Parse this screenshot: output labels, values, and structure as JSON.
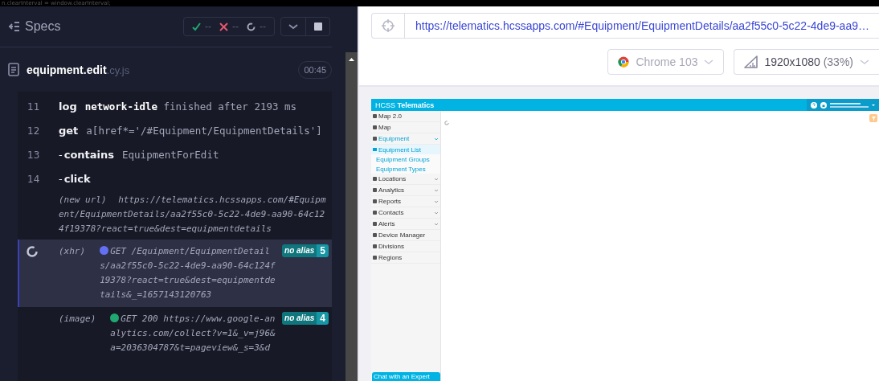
{
  "code_strip": "n.clearInterval = window.clearInterval;",
  "specs": {
    "title": "Specs",
    "passed": "--",
    "failed": "--",
    "pending": "--"
  },
  "spec_file": {
    "name": "equipment.edit",
    "ext": ".cy.js",
    "duration": "00:45"
  },
  "commands": [
    {
      "kind": "command",
      "number": "11",
      "name": "log",
      "message": "**network-idle** finished after 2193 ms"
    },
    {
      "kind": "command",
      "number": "12",
      "name": "get",
      "message": "a[href*='/#Equipment/EquipmentDetails']"
    },
    {
      "kind": "child",
      "number": "13",
      "prefix": "-",
      "name": "contains",
      "message": "EquipmentForEdit"
    },
    {
      "kind": "child",
      "number": "14",
      "prefix": "-",
      "name": "click"
    },
    {
      "kind": "event",
      "label": "(new url)",
      "message": "https://telematics.hcssapps.com/#Equipment/EquipmentDetails/aa2f55c0-5c22-4de9-aa90-64c124f19378?react=true&dest=equipmentdetails"
    },
    {
      "kind": "request",
      "label": "(xhr)",
      "color": "#6470f3",
      "message": "GET /Equipment/EquipmentDetails/aa2f55c0-5c22-4de9-aa90-64c124f19378?react=true&dest=equipmentdetails&_=1657143120763",
      "alias": "no alias",
      "count": "5",
      "pending": true,
      "selected": true
    },
    {
      "kind": "request",
      "label": "(image)",
      "color": "#1fa971",
      "message": "GET 200 https://www.google-analytics.com/collect?v=1&_v=j96&a=2036304787&t=pageview&_s=3&d",
      "alias": "no alias",
      "count": "4",
      "pending": false,
      "selected": false
    }
  ],
  "runner": {
    "url": "https://telematics.hcssapps.com/#Equipment/EquipmentDetails/aa2f55c0-5c22-4de9-aa9…",
    "browser": "Chrome 103",
    "viewport": "1920x1080",
    "scale": "(33%)"
  },
  "preview": {
    "app_title": "HCSS **Telematics**",
    "chat_button": "Chat with an Expert",
    "sidebar": [
      {
        "kind": "link",
        "label": "Map 2.0"
      },
      {
        "kind": "link",
        "label": "Map"
      },
      {
        "kind": "group",
        "label": "Equipment",
        "expanded": true,
        "children": [
          {
            "label": "Equipment List",
            "selected": true
          },
          {
            "label": "Equipment Groups",
            "selected": false
          },
          {
            "label": "Equipment Types",
            "selected": false
          }
        ]
      },
      {
        "kind": "group",
        "label": "Locations",
        "expanded": false
      },
      {
        "kind": "group",
        "label": "Analytics",
        "expanded": false
      },
      {
        "kind": "group",
        "label": "Reports",
        "expanded": false
      },
      {
        "kind": "group",
        "label": "Contacts",
        "expanded": false
      },
      {
        "kind": "group",
        "label": "Alerts",
        "expanded": false
      },
      {
        "kind": "link",
        "label": "Device Manager"
      },
      {
        "kind": "link",
        "label": "Divisions"
      },
      {
        "kind": "link",
        "label": "Regions"
      }
    ]
  }
}
